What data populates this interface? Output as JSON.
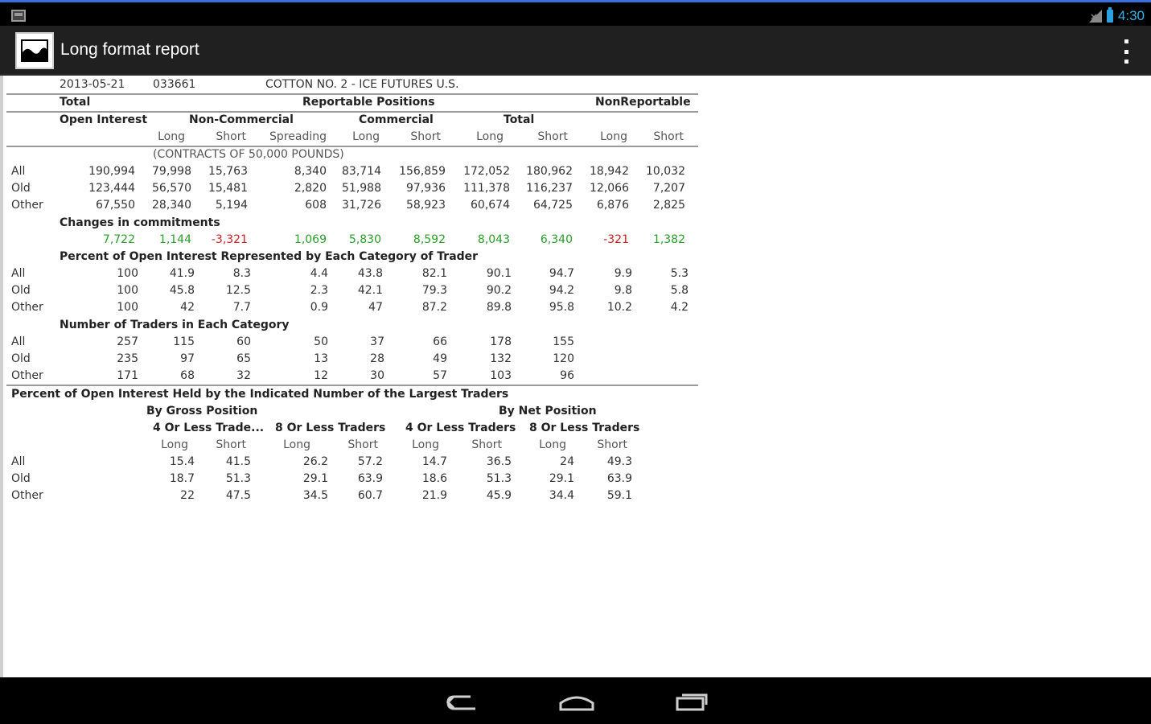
{
  "statusbar": {
    "time": "4:30"
  },
  "actionbar": {
    "title": "Long format report"
  },
  "report": {
    "date": "2013-05-21",
    "code": "033661",
    "market": "COTTON NO. 2 - ICE FUTURES U.S.",
    "hdr1": {
      "total": "Total",
      "reportable": "Reportable Positions",
      "nonreportable": "NonReportable"
    },
    "hdr2": {
      "open_interest": "Open Interest",
      "noncommercial": "Non-Commercial",
      "commercial": "Commercial",
      "total": "Total"
    },
    "hdr3": [
      "Long",
      "Short",
      "Spreading",
      "Long",
      "Short",
      "Long",
      "Short",
      "Long",
      "Short"
    ],
    "units": "(CONTRACTS OF 50,000 POUNDS)",
    "positions": [
      {
        "label": "All",
        "v": [
          "190,994",
          "79,998",
          "15,763",
          "8,340",
          "83,714",
          "156,859",
          "172,052",
          "180,962",
          "18,942",
          "10,032"
        ]
      },
      {
        "label": "Old",
        "v": [
          "123,444",
          "56,570",
          "15,481",
          "2,820",
          "51,988",
          "97,936",
          "111,378",
          "116,237",
          "12,066",
          "7,207"
        ]
      },
      {
        "label": "Other",
        "v": [
          "67,550",
          "28,340",
          "5,194",
          "608",
          "31,726",
          "58,923",
          "60,674",
          "64,725",
          "6,876",
          "2,825"
        ]
      }
    ],
    "changes_title": "Changes in commitments",
    "changes": [
      "7,722",
      "1,144",
      "-3,321",
      "1,069",
      "5,830",
      "8,592",
      "8,043",
      "6,340",
      "-321",
      "1,382"
    ],
    "percent_title": "Percent of Open Interest Represented by Each Category of Trader",
    "percent": [
      {
        "label": "All",
        "v": [
          "100",
          "41.9",
          "8.3",
          "4.4",
          "43.8",
          "82.1",
          "90.1",
          "94.7",
          "9.9",
          "5.3"
        ]
      },
      {
        "label": "Old",
        "v": [
          "100",
          "45.8",
          "12.5",
          "2.3",
          "42.1",
          "79.3",
          "90.2",
          "94.2",
          "9.8",
          "5.8"
        ]
      },
      {
        "label": "Other",
        "v": [
          "100",
          "42",
          "7.7",
          "0.9",
          "47",
          "87.2",
          "89.8",
          "95.8",
          "10.2",
          "4.2"
        ]
      }
    ],
    "traders_title": "Number of Traders in Each Category",
    "traders": [
      {
        "label": "All",
        "v": [
          "257",
          "115",
          "60",
          "50",
          "37",
          "66",
          "178",
          "155"
        ]
      },
      {
        "label": "Old",
        "v": [
          "235",
          "97",
          "65",
          "13",
          "28",
          "49",
          "132",
          "120"
        ]
      },
      {
        "label": "Other",
        "v": [
          "171",
          "68",
          "32",
          "12",
          "30",
          "57",
          "103",
          "96"
        ]
      }
    ],
    "largest_title": "Percent of Open Interest Held by the Indicated Number of the Largest Traders",
    "by_gross": "By Gross Position",
    "by_net": "By Net Position",
    "largest_groups": [
      "4 Or Less Trade...",
      "8 Or Less Traders",
      "4 Or Less Traders",
      "8 Or Less Traders"
    ],
    "largest_cols": [
      "Long",
      "Short",
      "Long",
      "Short",
      "Long",
      "Short",
      "Long",
      "Short"
    ],
    "largest": [
      {
        "label": "All",
        "v": [
          "15.4",
          "41.5",
          "26.2",
          "57.2",
          "14.7",
          "36.5",
          "24",
          "49.3"
        ]
      },
      {
        "label": "Old",
        "v": [
          "18.7",
          "51.3",
          "29.1",
          "63.9",
          "18.6",
          "51.3",
          "29.1",
          "63.9"
        ]
      },
      {
        "label": "Other",
        "v": [
          "22",
          "47.5",
          "34.5",
          "60.7",
          "21.9",
          "45.9",
          "34.4",
          "59.1"
        ]
      }
    ]
  }
}
